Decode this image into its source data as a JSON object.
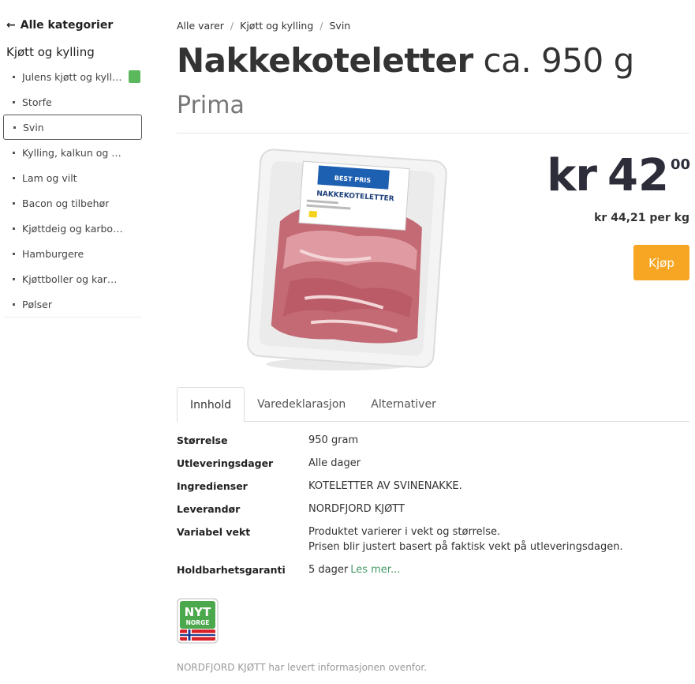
{
  "sidebar": {
    "back_label": "Alle kategorier",
    "category_title": "Kjøtt og kylling",
    "items": [
      {
        "label": "Julens kjøtt og kylling"
      },
      {
        "label": "Storfe"
      },
      {
        "label": "Svin"
      },
      {
        "label": "Kylling, kalkun og and"
      },
      {
        "label": "Lam og vilt"
      },
      {
        "label": "Bacon og tilbehør"
      },
      {
        "label": "Kjøttdeig og karbonadedeig"
      },
      {
        "label": "Hamburgere"
      },
      {
        "label": "Kjøttboller og karbonader"
      },
      {
        "label": "Pølser"
      }
    ],
    "active_index": 2
  },
  "breadcrumb": [
    "Alle varer",
    "Kjøtt og kylling",
    "Svin"
  ],
  "product": {
    "name": "Nakkekoteletter",
    "size_suffix": "ca. 950 g",
    "brand": "Prima",
    "package_label_top": "BEST PRIS",
    "package_label_name": "NAKKEKOTELETTER"
  },
  "price": {
    "currency": "kr",
    "whole": "42",
    "cents": "00",
    "unit_price": "kr 44,21 per kg"
  },
  "buy_label": "Kjøp",
  "tabs": [
    "Innhold",
    "Varedeklarasjon",
    "Alternativer"
  ],
  "details": [
    {
      "key": "Størrelse",
      "value": "950 gram"
    },
    {
      "key": "Utleveringsdager",
      "value": "Alle dager"
    },
    {
      "key": "Ingredienser",
      "value": "KOTELETTER AV SVINENAKKE."
    },
    {
      "key": "Leverandør",
      "value": "NORDFJORD KJØTT"
    },
    {
      "key": "Variabel vekt",
      "value": "Produktet varierer i vekt og størrelse.",
      "value2": "Prisen blir justert basert på faktisk vekt på utleveringsdagen."
    },
    {
      "key": "Holdbarhetsgaranti",
      "value": "5 dager",
      "link": "Les mer..."
    }
  ],
  "nyt_logo": {
    "line1": "NYT",
    "line2": "NORGE"
  },
  "footer_note": "NORDFJORD KJØTT har levert informasjonen ovenfor.",
  "colors": {
    "buy": "#f6a623",
    "price": "#2d2d3a",
    "link": "#4a9a6a",
    "badge": "#5cb85c"
  }
}
